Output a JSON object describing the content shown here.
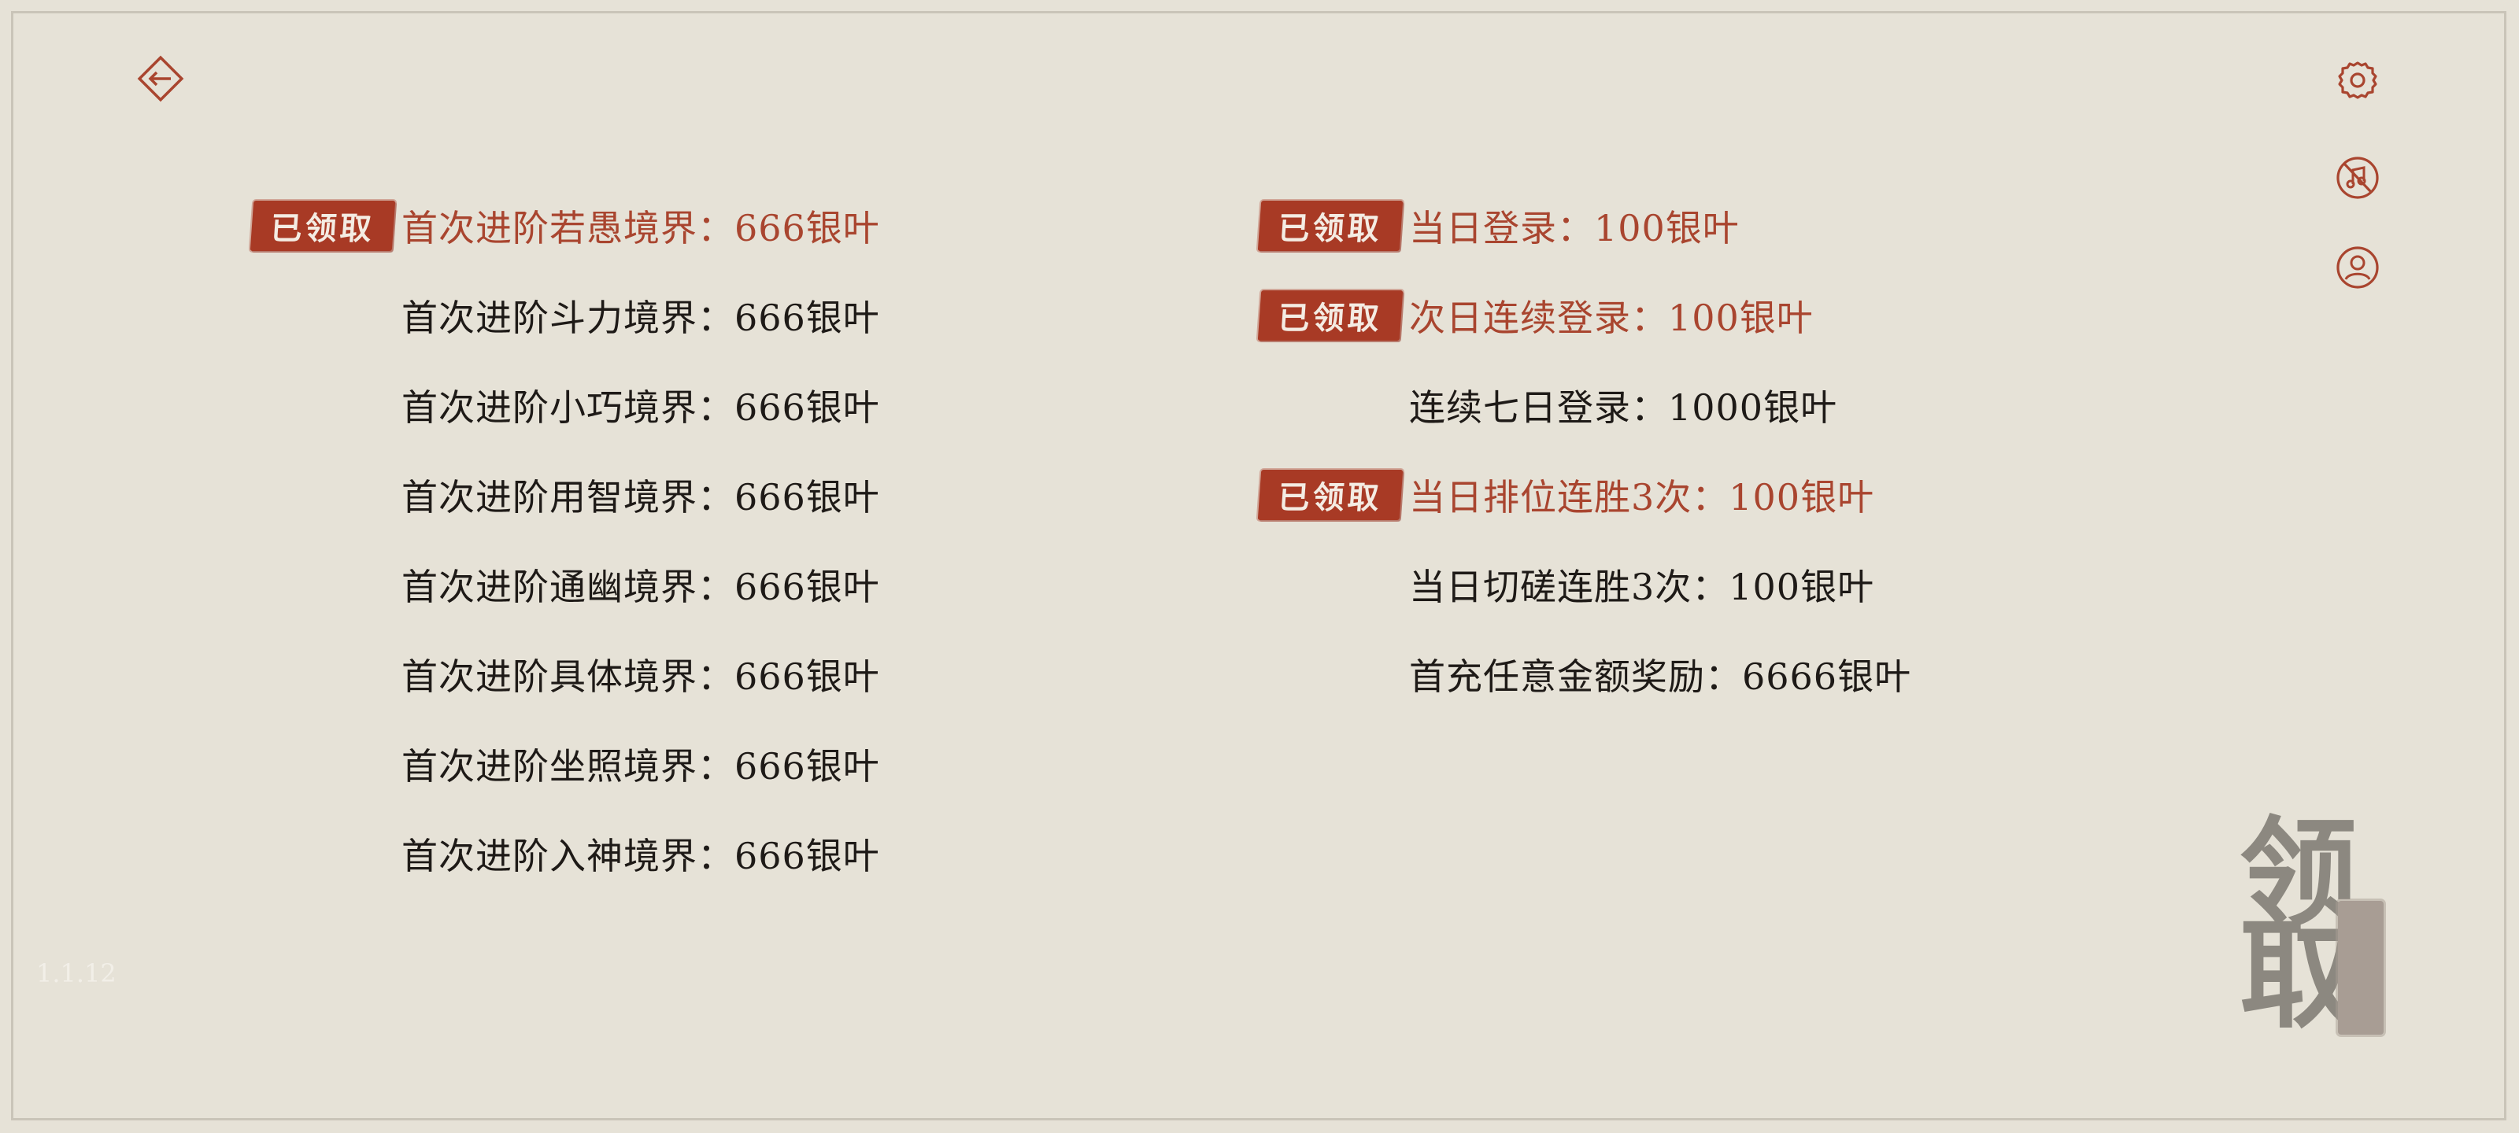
{
  "app": {
    "version": "1.1.12"
  },
  "toolbar": {
    "back_icon": "back-arrow-icon",
    "settings_icon": "gear-icon",
    "music_icon": "music-off-icon",
    "profile_icon": "user-icon"
  },
  "stamp_label": "已领取",
  "left_rewards": [
    {
      "text": "首次进阶若愚境界：666银叶",
      "claimed": true
    },
    {
      "text": "首次进阶斗力境界：666银叶",
      "claimed": false
    },
    {
      "text": "首次进阶小巧境界：666银叶",
      "claimed": false
    },
    {
      "text": "首次进阶用智境界：666银叶",
      "claimed": false
    },
    {
      "text": "首次进阶通幽境界：666银叶",
      "claimed": false
    },
    {
      "text": "首次进阶具体境界：666银叶",
      "claimed": false
    },
    {
      "text": "首次进阶坐照境界：666银叶",
      "claimed": false
    },
    {
      "text": "首次进阶入神境界：666银叶",
      "claimed": false
    }
  ],
  "right_rewards": [
    {
      "text": "当日登录：100银叶",
      "claimed": true
    },
    {
      "text": "次日连续登录：100银叶",
      "claimed": true
    },
    {
      "text": "连续七日登录：1000银叶",
      "claimed": false
    },
    {
      "text": "当日排位连胜3次：100银叶",
      "claimed": true
    },
    {
      "text": "当日切磋连胜3次：100银叶",
      "claimed": false
    },
    {
      "text": "首充任意金额奖励：6666银叶",
      "claimed": false
    }
  ],
  "claim_button": {
    "char_1": "领",
    "char_2": "取"
  },
  "colors": {
    "background": "#e6e2d7",
    "accent": "#a9452f",
    "stamp": "#a83a25",
    "text": "#1e1a17"
  }
}
